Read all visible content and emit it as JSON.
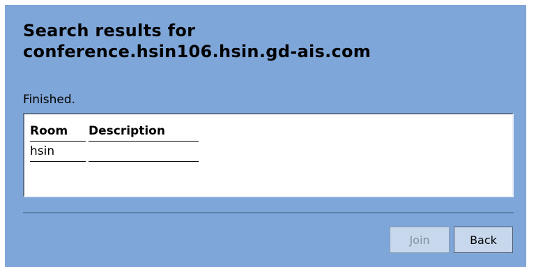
{
  "dialog": {
    "title_line1": "Search results for",
    "title_line2": "conference.hsin106.hsin.gd-ais.com",
    "status": "Finished."
  },
  "results_table": {
    "columns": [
      "Room",
      "Description"
    ],
    "rows": [
      {
        "room": "hsin",
        "description": ""
      }
    ]
  },
  "buttons": {
    "join_label": "Join",
    "join_enabled": false,
    "back_label": "Back"
  },
  "colors": {
    "panel_background": "#7fa6d8",
    "button_background": "#c8d8ec",
    "disabled_text": "#7f8ea0"
  }
}
